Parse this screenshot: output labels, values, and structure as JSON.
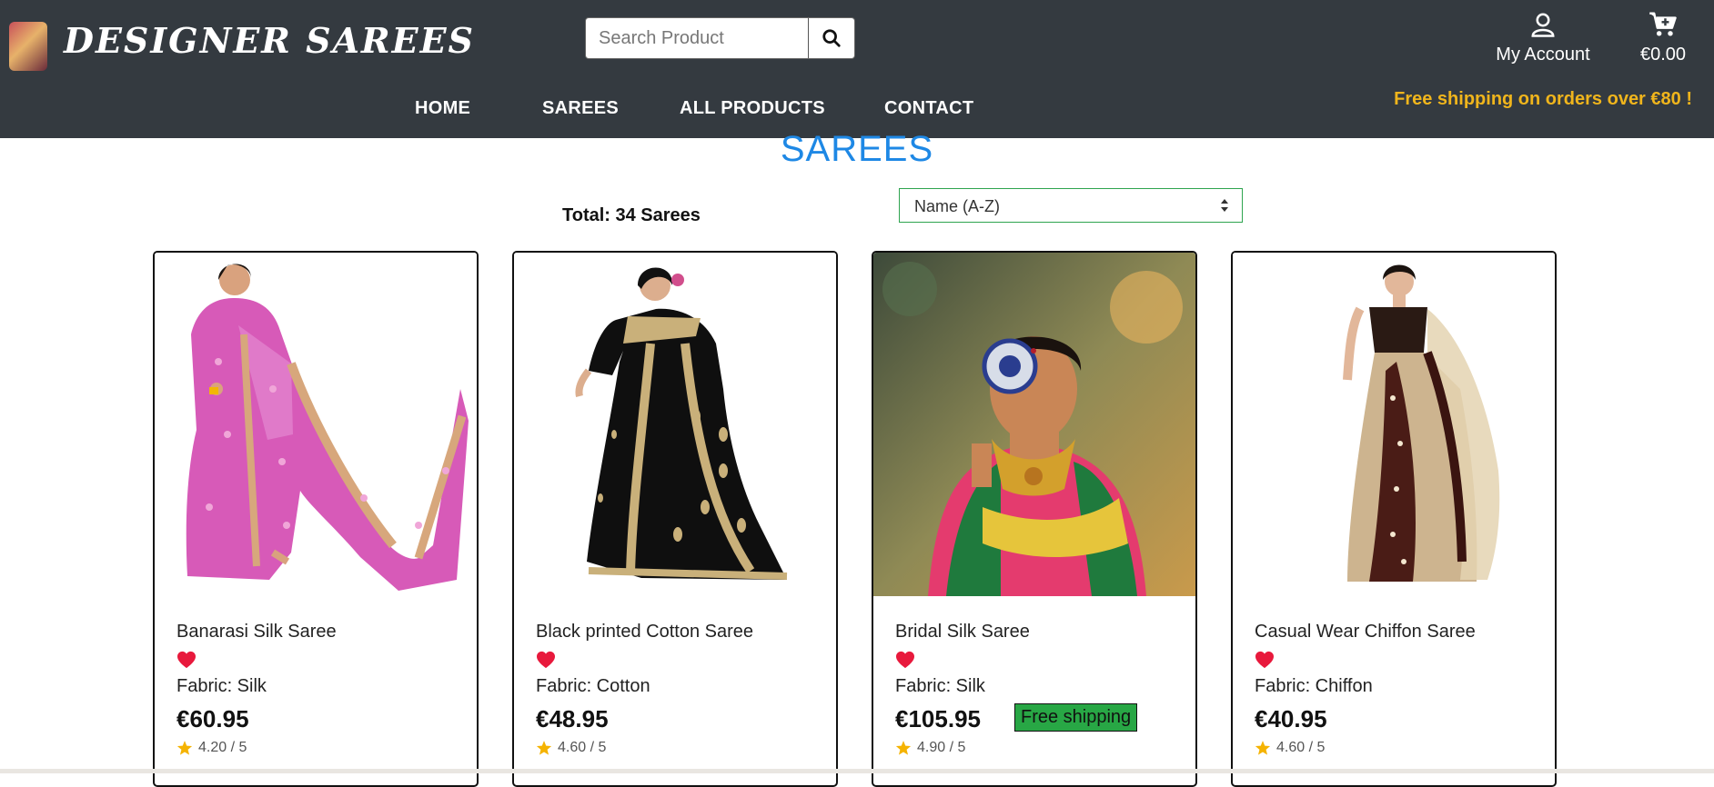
{
  "header": {
    "brand": "DESIGNER SAREES",
    "search": {
      "placeholder": "Search Product",
      "value": ""
    },
    "account_label": "My Account",
    "cart_total": "€0.00",
    "nav": [
      "HOME",
      "SAREES",
      "ALL PRODUCTS",
      "CONTACT"
    ],
    "promo": "Free shipping on orders over €80 !"
  },
  "main": {
    "title": "SAREES",
    "total": "Total: 34 Sarees",
    "sort_selected": "Name (A-Z)"
  },
  "products": [
    {
      "name": "Banarasi Silk Saree",
      "fabric": "Fabric: Silk",
      "price": "€60.95",
      "rating": "4.20 / 5"
    },
    {
      "name": "Black printed Cotton Saree",
      "fabric": "Fabric: Cotton",
      "price": "€48.95",
      "rating": "4.60 / 5"
    },
    {
      "name": "Bridal Silk Saree",
      "fabric": "Fabric: Silk",
      "price": "€105.95",
      "badge": "Free shipping",
      "rating": "4.90 / 5"
    },
    {
      "name": "Casual Wear Chiffon Saree",
      "fabric": "Fabric: Chiffon",
      "price": "€40.95",
      "rating": "4.60 / 5"
    }
  ],
  "colors": {
    "header_bg": "#343a40",
    "promo": "#f0b51c",
    "title": "#1e88e5",
    "heart": "#e8193c",
    "star": "#f5b301",
    "badge": "#28a745"
  },
  "icons": [
    "search-icon",
    "user-icon",
    "cart-icon",
    "heart-icon",
    "star-icon",
    "sort-arrows-icon"
  ]
}
